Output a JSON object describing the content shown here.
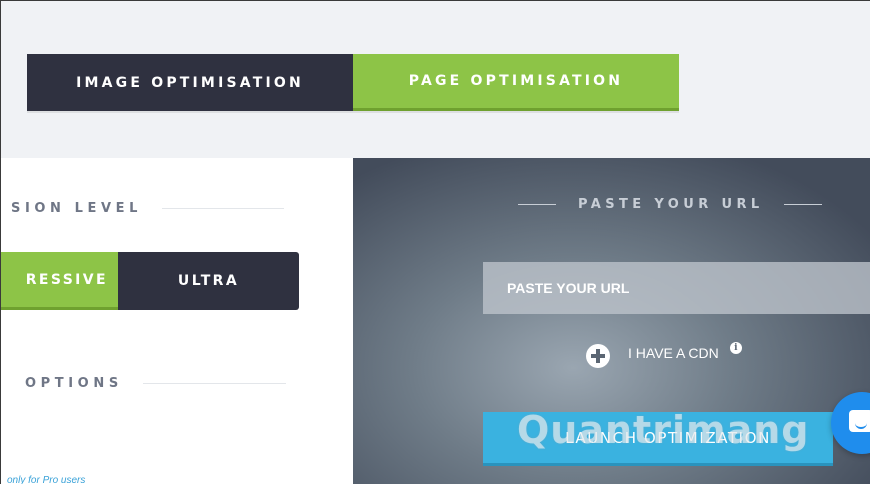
{
  "mode_tabs": {
    "image_label": "IMAGE OPTIMISATION",
    "page_label": "PAGE OPTIMISATION",
    "active": "page"
  },
  "compression": {
    "heading": "SION LEVEL",
    "aggressive_label": "RESSIVE",
    "ultra_label": "ULTRA",
    "active": "aggressive"
  },
  "options": {
    "heading": "OPTIONS",
    "pro_note": "only for Pro users"
  },
  "url_section": {
    "heading": "PASTE YOUR URL",
    "input_placeholder": "PASTE YOUR URL",
    "cdn_label": "I HAVE A CDN",
    "launch_label": "LAUNCH OPTIMIZATION"
  },
  "watermark": "Quantrimang",
  "icons": {
    "plus": "plus-icon",
    "info": "info-icon",
    "chat": "chat-icon"
  },
  "colors": {
    "dark": "#2f3140",
    "green": "#8dc447",
    "blue": "#3ab2e0",
    "chat_blue": "#1f8ded",
    "top_band": "#f0f2f5"
  }
}
